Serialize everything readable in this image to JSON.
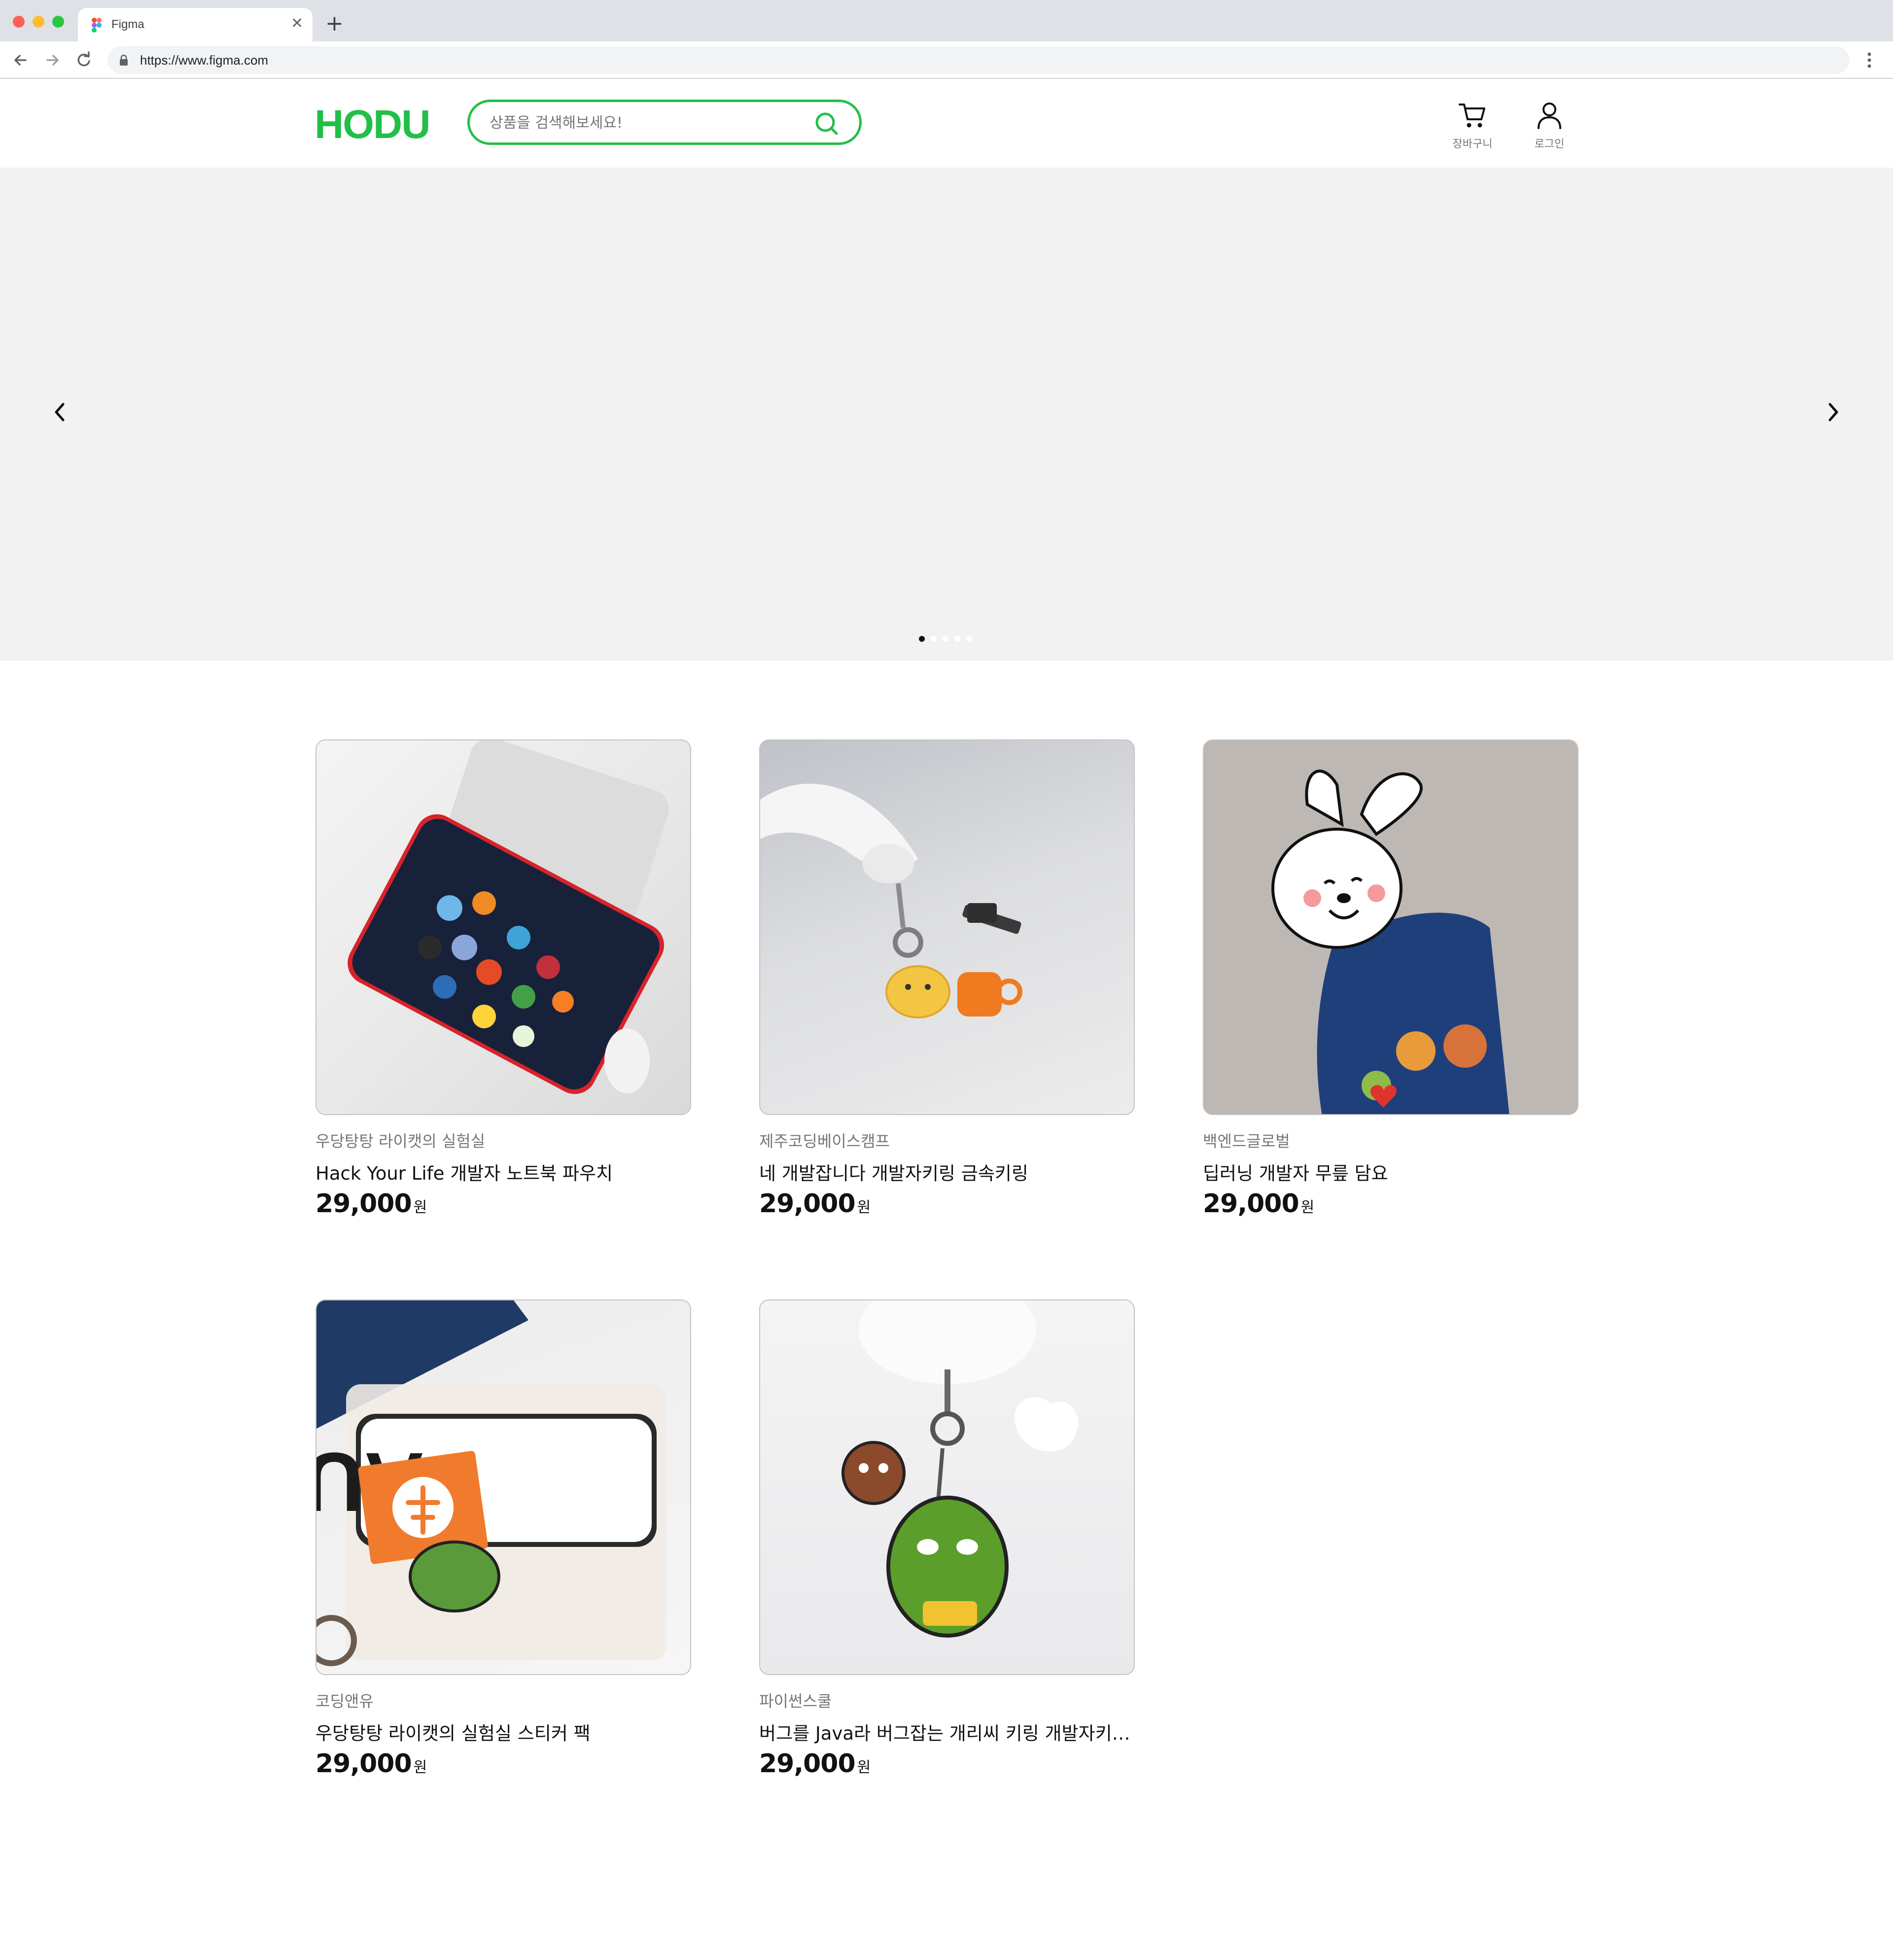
{
  "browser": {
    "tab_title": "Figma",
    "url": "https://www.figma.com",
    "new_tab_icon": "plus-icon",
    "close_tab_icon": "close-icon"
  },
  "header": {
    "logo_text": "HODU",
    "search_placeholder": "상품을 검색해보세요!",
    "cart_label": "장바구니",
    "login_label": "로그인"
  },
  "colors": {
    "brand": "#21bf48",
    "banner_bg": "#f2f2f2",
    "text_muted": "#767676"
  },
  "banner": {
    "slide_count": 5,
    "active_slide": 1
  },
  "products": [
    {
      "seller": "우당탕탕 라이캣의 실험실",
      "name": "Hack Your Life 개발자 노트북 파우치",
      "price": "29,000",
      "unit": "원"
    },
    {
      "seller": "제주코딩베이스캠프",
      "name": "네 개발잡니다 개발자키링 금속키링",
      "price": "29,000",
      "unit": "원"
    },
    {
      "seller": "백엔드글로벌",
      "name": "딥러닝 개발자 무릎 담요",
      "price": "29,000",
      "unit": "원"
    },
    {
      "seller": "코딩앤유",
      "name": "우당탕탕 라이캣의 실험실 스티커 팩",
      "price": "29,000",
      "unit": "원"
    },
    {
      "seller": "파이썬스쿨",
      "name": "버그를 Java라 버그잡는 개리씨 키링 개발자키링...",
      "price": "29,000",
      "unit": "원"
    }
  ]
}
